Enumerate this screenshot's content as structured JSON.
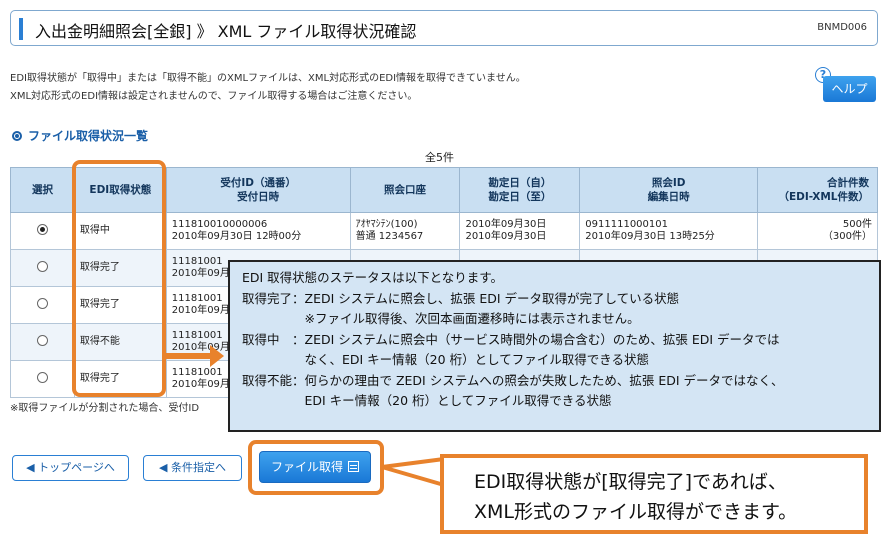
{
  "header": {
    "title": "入出金明細照会[全銀] 》 XML ファイル取得状況確認",
    "code": "BNMD006"
  },
  "notice": {
    "line1": "EDI取得状態が「取得中」または「取得不能」のXMLファイルは、XML対応形式のEDI情報を取得できていません。",
    "line2": "XML対応形式のEDI情報は設定されませんので、ファイル取得する場合はご注意ください。"
  },
  "help": {
    "q": "?",
    "label": "ヘルプ"
  },
  "section": {
    "title": "ファイル取得状況一覧"
  },
  "count": "全5件",
  "table": {
    "headers": {
      "select": "選択",
      "status": "EDI取得状態",
      "receipt_1": "受付ID（通番）",
      "receipt_2": "受付日時",
      "account": "照会口座",
      "period_1": "勘定日（自）",
      "period_2": "勘定日（至）",
      "inquiry_1": "照会ID",
      "inquiry_2": "編集日時",
      "total_1": "合計件数",
      "total_2": "（EDI-XML件数）"
    },
    "rows": [
      {
        "status": "取得中",
        "receipt_id": "111810010000006",
        "receipt_at": "2010年09月30日 12時00分",
        "account_1": "ｱｵﾔﾏｼﾃﾝ(100)",
        "account_2": "普通 1234567",
        "from": "2010年09月30日",
        "to": "2010年09月30日",
        "inquiry_id": "0911111000101",
        "edited_at": "2010年09月30日 13時25分",
        "total": "500件",
        "edi": "（300件）"
      },
      {
        "status": "取得完了",
        "receipt_id": "11181001",
        "receipt_at": "2010年09月"
      },
      {
        "status": "取得完了",
        "receipt_id": "11181001",
        "receipt_at": "2010年09月"
      },
      {
        "status": "取得不能",
        "receipt_id": "11181001",
        "receipt_at": "2010年09月"
      },
      {
        "status": "取得完了",
        "receipt_id": "11181001",
        "receipt_at": "2010年09月"
      }
    ]
  },
  "footnote": "※取得ファイルが分割された場合、受付ID",
  "popup": {
    "lines": [
      "EDI 取得状態のステータスは以下となります。",
      "取得完了：ZEDI システムに照会し、拡張 EDI データ取得が完了している状態",
      "　　　　　※ファイル取得後、次回本画面遷移時には表示されません。",
      "取得中　：ZEDI システムに照会中（サービス時間外の場合含む）のため、拡張 EDI データでは",
      "　　　　　なく、EDI キー情報（20 桁）としてファイル取得できる状態",
      "取得不能：何らかの理由で ZEDI システムへの照会が失敗したため、拡張 EDI データではなく、",
      "　　　　　EDI キー情報（20 桁）としてファイル取得できる状態"
    ]
  },
  "buttons": {
    "top": "◀ トップページへ",
    "condition": "◀ 条件指定へ",
    "get_file": "ファイル取得"
  },
  "callout": {
    "line1": "EDI取得状態が[取得完了]であれば、",
    "line2": "XML形式のファイル取得ができます。"
  },
  "colors": {
    "highlight": "#e8822c",
    "accent": "#2a7fd4",
    "error": "#d51414"
  }
}
